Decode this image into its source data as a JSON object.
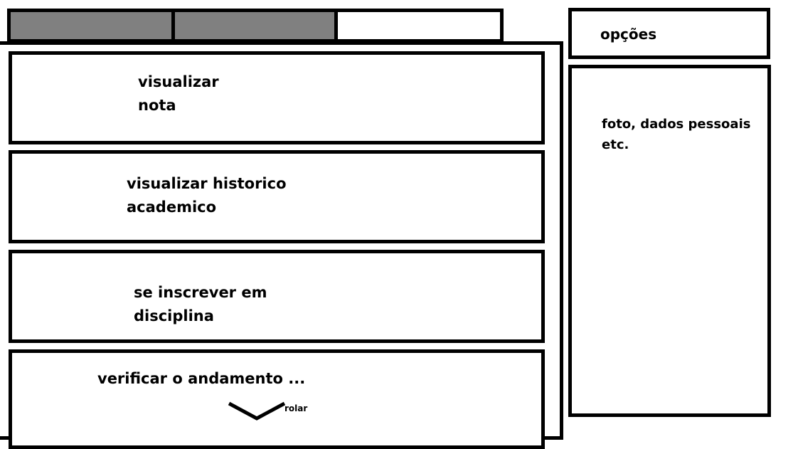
{
  "tabs": [
    {
      "label": "",
      "state": "inactive",
      "color": "#808080"
    },
    {
      "label": "",
      "state": "inactive",
      "color": "#808080"
    },
    {
      "label": "",
      "state": "active",
      "color": "#ffffff"
    }
  ],
  "menu": {
    "items": [
      {
        "label": "visualizar\nnota"
      },
      {
        "label": "visualizar historico\nacademico"
      },
      {
        "label": "se inscrever em\ndisciplina"
      },
      {
        "label": "verificar o andamento ..."
      }
    ],
    "scroll": {
      "label": "rolar",
      "icon": "chevron-down-icon"
    }
  },
  "options": {
    "label": "opções"
  },
  "profile": {
    "label": "foto, dados pessoais\netc."
  }
}
